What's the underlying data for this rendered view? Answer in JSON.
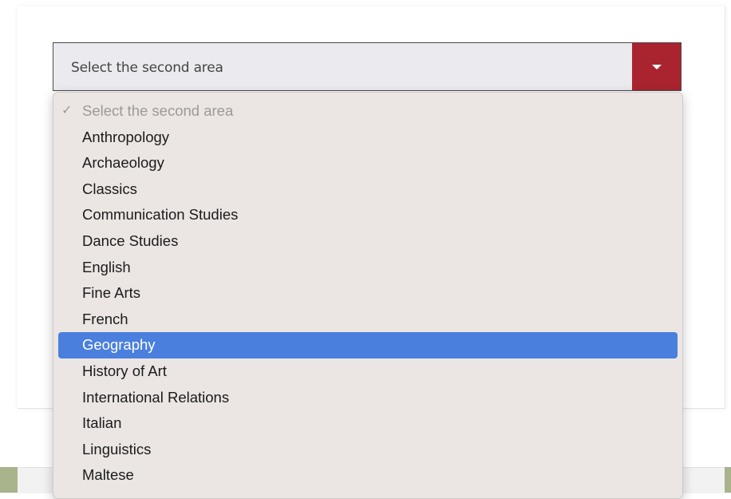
{
  "select": {
    "value": "Select the second area",
    "toggle_color": "#a9242f"
  },
  "dropdown": {
    "placeholder": "Select the second area",
    "check_mark": "✓",
    "highlighted": "Geography",
    "options": [
      "Anthropology",
      "Archaeology",
      "Classics",
      "Communication Studies",
      "Dance Studies",
      "English",
      "Fine Arts",
      "French",
      "Geography",
      "History of Art",
      "International Relations",
      "Italian",
      "Linguistics",
      "Maltese"
    ]
  },
  "colors": {
    "highlight": "#4a7fde",
    "dropdown_bg": "#ebe6e3",
    "select_bg": "#ebeaee",
    "footer_accent": "#a9b38c"
  }
}
